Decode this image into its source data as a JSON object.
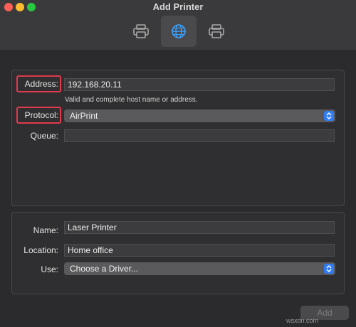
{
  "window": {
    "title": "Add Printer"
  },
  "toolbar": {
    "items": [
      {
        "icon": "printer-icon",
        "active": false
      },
      {
        "icon": "globe-icon",
        "active": true
      },
      {
        "icon": "printer-icon",
        "active": false
      }
    ]
  },
  "network": {
    "address_label": "Address:",
    "address_value": "192.168.20.11",
    "address_hint": "Valid and complete host name or address.",
    "protocol_label": "Protocol:",
    "protocol_value": "AirPrint",
    "queue_label": "Queue:",
    "queue_value": ""
  },
  "details": {
    "name_label": "Name:",
    "name_value": "Laser Printer",
    "location_label": "Location:",
    "location_value": "Home office",
    "use_label": "Use:",
    "use_value": "Choose a Driver..."
  },
  "footer": {
    "add_label": "Add",
    "watermark": "wsxdn.com"
  },
  "colors": {
    "highlight": "#e03a4c",
    "accent": "#2f7cf6"
  }
}
